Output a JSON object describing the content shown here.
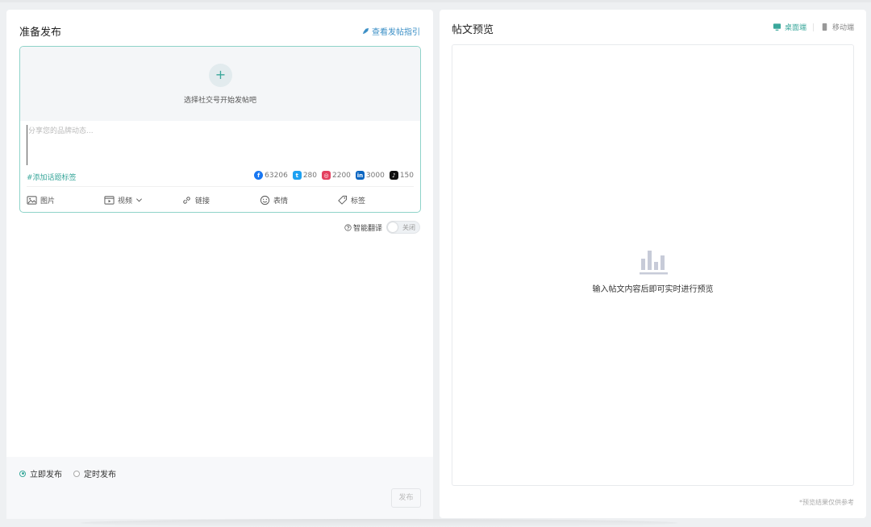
{
  "left": {
    "title": "准备发布",
    "guide_link": "查看发帖指引",
    "account_hint": "选择社交号开始发帖吧",
    "add_account": "+",
    "post_placeholder": "分享您的品牌动态...",
    "hashtag": "#添加话题标签",
    "limits": [
      {
        "network": "facebook",
        "glyph": "f",
        "value": "63206",
        "color": "#1877f2"
      },
      {
        "network": "twitter",
        "glyph": "t",
        "value": "280",
        "color": "#1da1f2"
      },
      {
        "network": "instagram",
        "glyph": "◎",
        "value": "2200",
        "color": "#e4405f"
      },
      {
        "network": "linkedin",
        "glyph": "in",
        "value": "3000",
        "color": "#0a66c2"
      },
      {
        "network": "tiktok",
        "glyph": "♪",
        "value": "150",
        "color": "#111111"
      }
    ],
    "toolbar": {
      "image": "图片",
      "video": "视频",
      "link": "链接",
      "emoji": "表情",
      "tag": "标签"
    },
    "translate": {
      "label": "智能翻译",
      "state": "关闭",
      "enabled": false
    }
  },
  "footer": {
    "publish_now": "立即发布",
    "publish_scheduled": "定时发布",
    "selected": "publish_now",
    "publish_button": "发布"
  },
  "right": {
    "title": "帖文预览",
    "desktop_tab": "桌面端",
    "mobile_tab": "移动端",
    "active_tab": "desktop",
    "empty_text": "输入帖文内容后即可实时进行预览",
    "note": "*预览结果仅供参考"
  },
  "colors": {
    "accent": "#3aa79b",
    "link": "#3b8fc6",
    "composer_border": "#8fd3c9"
  }
}
